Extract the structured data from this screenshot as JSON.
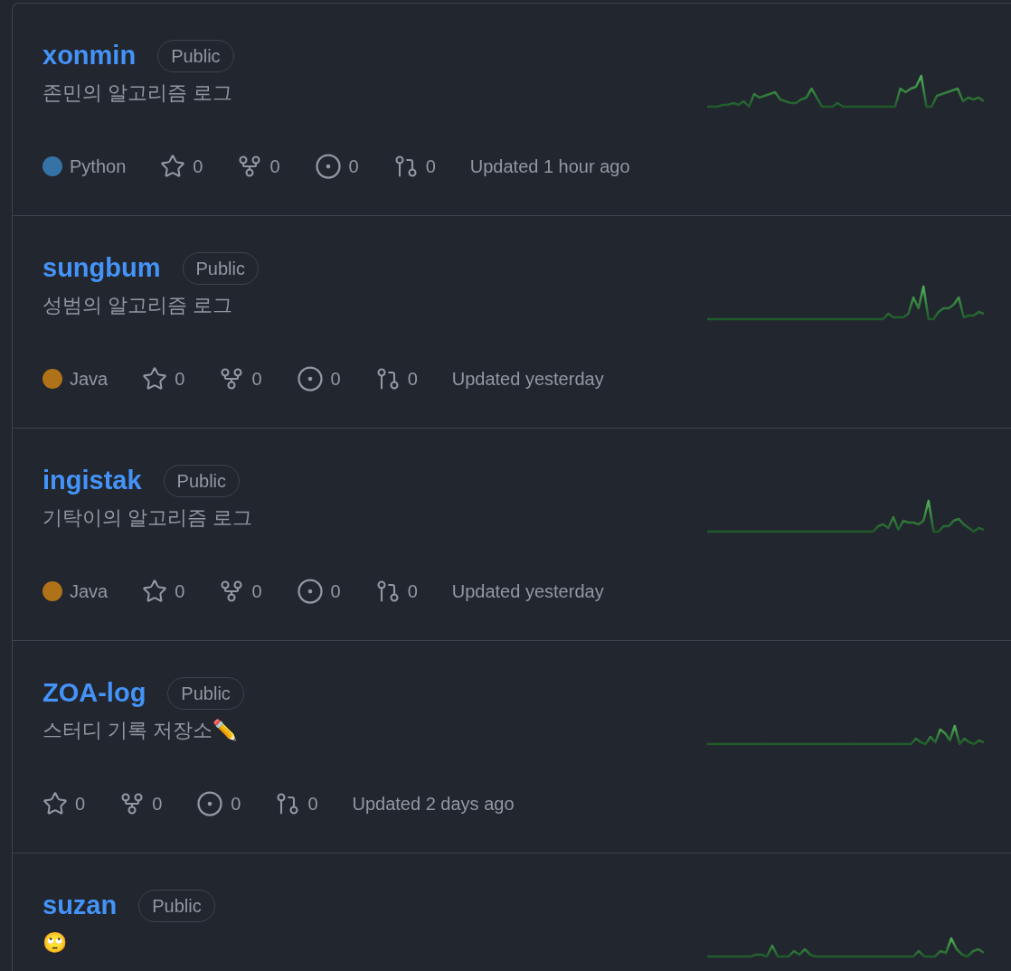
{
  "repositories": [
    {
      "name": "xonmin",
      "visibility": "Public",
      "description": "존민의 알고리즘 로그",
      "language": {
        "name": "Python",
        "color": "#3572a5"
      },
      "stars": "0",
      "forks": "0",
      "issues": "0",
      "pulls": "0",
      "updated": "Updated 1 hour ago"
    },
    {
      "name": "sungbum",
      "visibility": "Public",
      "description": "성범의 알고리즘 로그",
      "language": {
        "name": "Java",
        "color": "#b07219"
      },
      "stars": "0",
      "forks": "0",
      "issues": "0",
      "pulls": "0",
      "updated": "Updated yesterday"
    },
    {
      "name": "ingistak",
      "visibility": "Public",
      "description": "기탁이의 알고리즘 로그",
      "language": {
        "name": "Java",
        "color": "#b07219"
      },
      "stars": "0",
      "forks": "0",
      "issues": "0",
      "pulls": "0",
      "updated": "Updated yesterday"
    },
    {
      "name": "ZOA-log",
      "visibility": "Public",
      "description": "스터디 기록 저장소✏️",
      "stars": "0",
      "forks": "0",
      "issues": "0",
      "pulls": "0",
      "updated": "Updated 2 days ago"
    },
    {
      "name": "suzan",
      "visibility": "Public",
      "description": "🙄"
    }
  ]
}
